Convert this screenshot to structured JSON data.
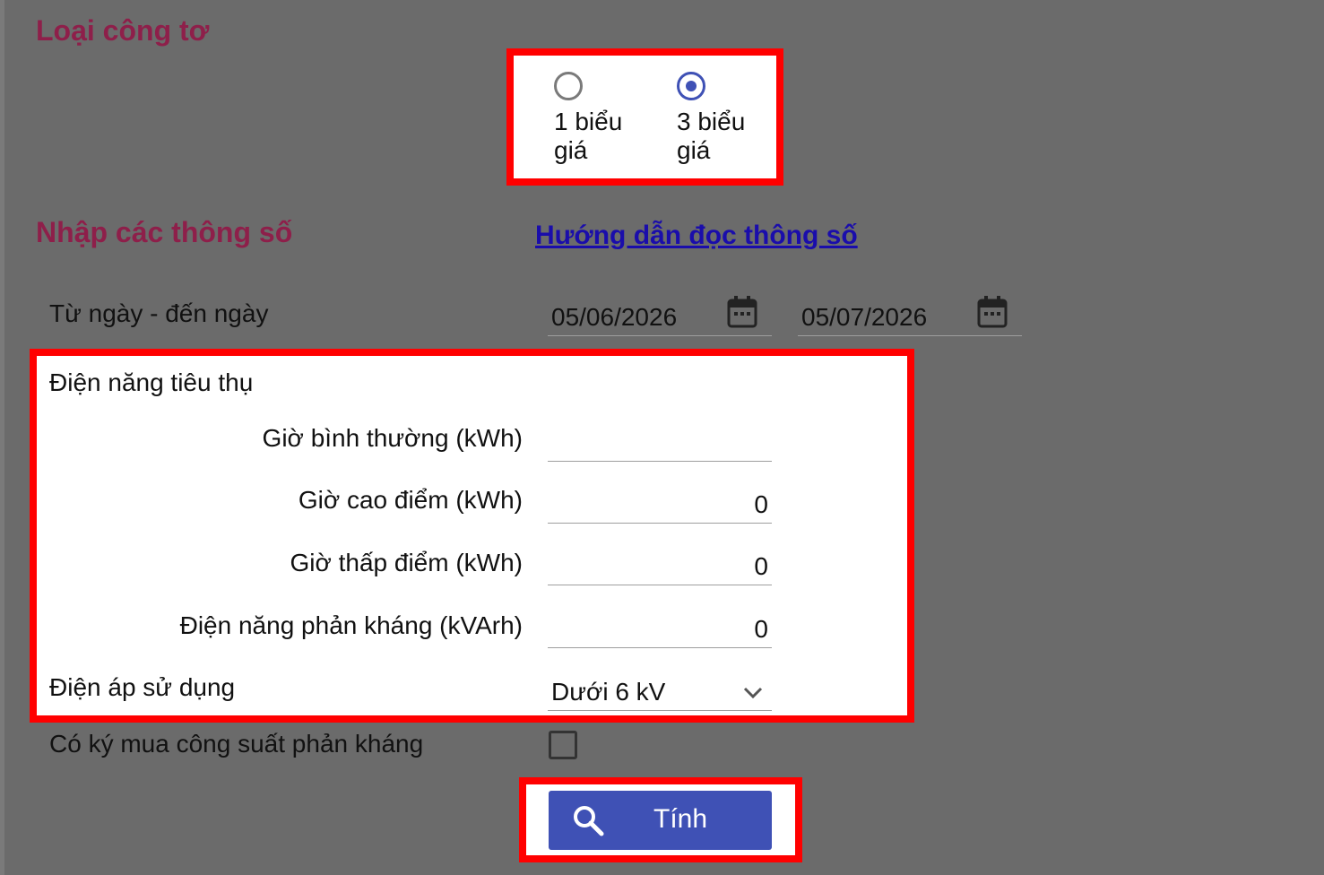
{
  "meter_type": {
    "title": "Loại công tơ",
    "options": [
      {
        "label": "1 biểu giá",
        "selected": false
      },
      {
        "label": "3 biểu giá",
        "selected": true
      }
    ]
  },
  "params": {
    "title": "Nhập các thông số",
    "guide_link": "Hướng dẫn đọc thông số",
    "date_range_label": "Từ ngày - đến ngày",
    "from_date": "05/06/2026",
    "to_date": "05/07/2026",
    "consumption_label": "Điện năng tiêu thụ",
    "normal_hours_label": "Giờ bình thường (kWh)",
    "normal_hours_value": "",
    "peak_hours_label": "Giờ cao điểm (kWh)",
    "peak_hours_value": "0",
    "offpeak_hours_label": "Giờ thấp điểm (kWh)",
    "offpeak_hours_value": "0",
    "reactive_label": "Điện năng phản kháng (kVArh)",
    "reactive_value": "0",
    "voltage_label": "Điện áp sử dụng",
    "voltage_value": "Dưới 6 kV",
    "reactive_contract_label": "Có ký mua công suất phản kháng",
    "reactive_contract_checked": false
  },
  "actions": {
    "calculate_label": "Tính"
  },
  "colors": {
    "highlight": "#ff0000",
    "accent": "#3f51b5",
    "section_title": "#8e1f4a",
    "link": "#1a0dab"
  }
}
